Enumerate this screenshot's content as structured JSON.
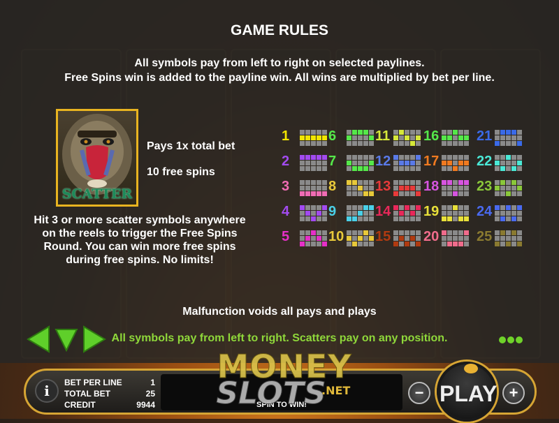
{
  "title": "GAME RULES",
  "rules": {
    "line1": "All symbols pay from left to right on selected paylines.",
    "line2": "Free Spins win is added to the payline win. All wins are multiplied by bet per line."
  },
  "scatter": {
    "symbol_label": "SCATTER",
    "pays": "Pays 1x total bet",
    "free_spins": "10 free spins",
    "description": "Hit 3 or more scatter symbols anywhere on the reels to trigger the Free Spins Round. You can win more free spins during free spins. No limits!"
  },
  "paylines": [
    {
      "num": "1",
      "color": "#f2e600",
      "rows": [
        1,
        1,
        1,
        1,
        1
      ]
    },
    {
      "num": "2",
      "color": "#a24bf0",
      "rows": [
        0,
        0,
        0,
        0,
        0
      ]
    },
    {
      "num": "3",
      "color": "#f06cb4",
      "rows": [
        2,
        2,
        2,
        2,
        2
      ]
    },
    {
      "num": "4",
      "color": "#a24bf0",
      "rows": [
        0,
        1,
        2,
        1,
        0
      ]
    },
    {
      "num": "5",
      "color": "#e62fc8",
      "rows": [
        2,
        1,
        0,
        1,
        2
      ]
    },
    {
      "num": "6",
      "color": "#55e84a",
      "rows": [
        1,
        0,
        0,
        0,
        1
      ]
    },
    {
      "num": "7",
      "color": "#55e84a",
      "rows": [
        1,
        2,
        2,
        2,
        1
      ]
    },
    {
      "num": "8",
      "color": "#e8c93a",
      "rows": [
        0,
        0,
        1,
        2,
        2
      ]
    },
    {
      "num": "9",
      "color": "#4ad0e8",
      "rows": [
        2,
        2,
        1,
        0,
        0
      ]
    },
    {
      "num": "10",
      "color": "#e8c93a",
      "rows": [
        1,
        2,
        1,
        0,
        1
      ]
    },
    {
      "num": "11",
      "color": "#d6e83a",
      "rows": [
        1,
        0,
        1,
        2,
        1
      ]
    },
    {
      "num": "12",
      "color": "#5a7ae8",
      "rows": [
        0,
        1,
        1,
        1,
        0
      ]
    },
    {
      "num": "13",
      "color": "#e83a3a",
      "rows": [
        2,
        1,
        1,
        1,
        2
      ]
    },
    {
      "num": "14",
      "color": "#e8285a",
      "rows": [
        0,
        1,
        0,
        1,
        0
      ]
    },
    {
      "num": "15",
      "color": "#b03a10",
      "rows": [
        2,
        1,
        2,
        1,
        2
      ]
    },
    {
      "num": "16",
      "color": "#55e84a",
      "rows": [
        1,
        1,
        0,
        1,
        1
      ]
    },
    {
      "num": "17",
      "color": "#f07a20",
      "rows": [
        1,
        1,
        2,
        1,
        1
      ]
    },
    {
      "num": "18",
      "color": "#d655e0",
      "rows": [
        0,
        0,
        2,
        0,
        0
      ]
    },
    {
      "num": "19",
      "color": "#e8e03a",
      "rows": [
        2,
        2,
        0,
        2,
        2
      ]
    },
    {
      "num": "20",
      "color": "#f06c8c",
      "rows": [
        0,
        2,
        2,
        2,
        0
      ]
    },
    {
      "num": "21",
      "color": "#3a6ae8",
      "rows": [
        2,
        0,
        0,
        0,
        2
      ]
    },
    {
      "num": "22",
      "color": "#4ae8d6",
      "rows": [
        1,
        2,
        0,
        2,
        1
      ]
    },
    {
      "num": "23",
      "color": "#8ac83a",
      "rows": [
        1,
        0,
        2,
        0,
        1
      ]
    },
    {
      "num": "24",
      "color": "#4a6af0",
      "rows": [
        0,
        2,
        0,
        2,
        0
      ]
    },
    {
      "num": "25",
      "color": "#8a7a30",
      "rows": [
        2,
        0,
        2,
        0,
        2
      ]
    }
  ],
  "malfunction": "Malfunction voids all pays and plays",
  "footer_rule": "All symbols pay from left to right. Scatters pay on any position.",
  "controls": {
    "info": "i",
    "bet_per_line_label": "BET PER LINE",
    "bet_per_line_value": "1",
    "total_bet_label": "TOTAL BET",
    "total_bet_value": "25",
    "credit_label": "CREDIT",
    "credit_value": "9944",
    "message": "SPIN TO WIN!",
    "minus": "−",
    "plus": "+",
    "play": "PLAY"
  },
  "watermark": {
    "money": "MONEY",
    "slots": "SLOTS",
    "net": ".NET"
  },
  "colors": {
    "accent_gold": "#e9b420",
    "green": "#6fd22a",
    "scatter_green": "#1e8a5a"
  }
}
